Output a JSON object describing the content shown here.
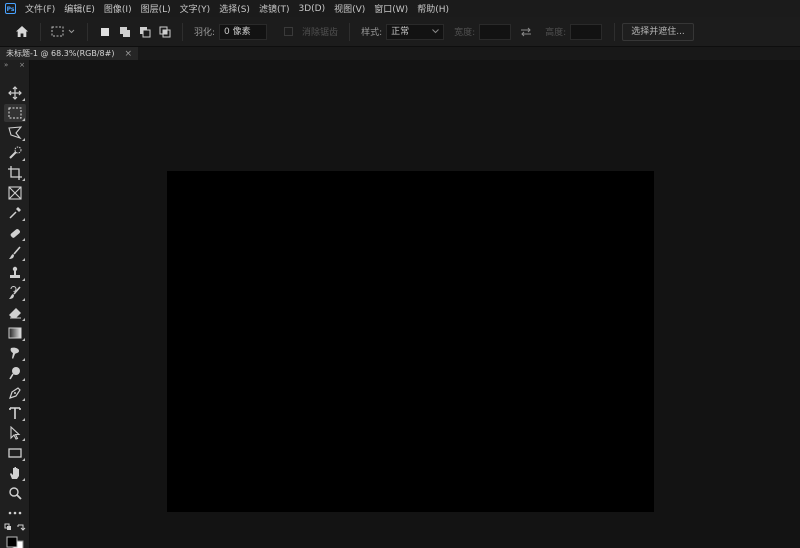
{
  "app": {
    "logo": "Ps"
  },
  "menu": [
    "文件(F)",
    "编辑(E)",
    "图像(I)",
    "图层(L)",
    "文字(Y)",
    "选择(S)",
    "滤镜(T)",
    "3D(D)",
    "视图(V)",
    "窗口(W)",
    "帮助(H)"
  ],
  "options": {
    "feather_label": "羽化:",
    "feather_value": "0 像素",
    "antialias_label": "消除锯齿",
    "style_label": "样式:",
    "style_value": "正常",
    "width_label": "宽度:",
    "height_label": "高度:",
    "select_mask_button": "选择并遮住..."
  },
  "document_tab": {
    "title": "未标题-1 @ 68.3%(RGB/8#)",
    "close": "×"
  },
  "toolbar_head": {
    "expand": "»",
    "close": "×"
  },
  "colors": {
    "background": "#131313",
    "panel": "#1c1c1c",
    "canvas": "#000000",
    "accent": "#4aa3ff"
  }
}
